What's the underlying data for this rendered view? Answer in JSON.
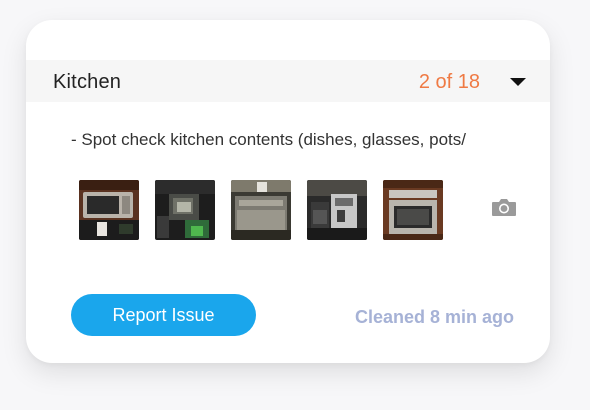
{
  "card": {
    "room": "Kitchen",
    "counter": "2 of 18",
    "task_text": "- Spot check kitchen contents (dishes, glasses, pots/",
    "photos": [
      {
        "icon": "photo-microwave"
      },
      {
        "icon": "photo-sink"
      },
      {
        "icon": "photo-dishwasher"
      },
      {
        "icon": "photo-coffee-machine"
      },
      {
        "icon": "photo-oven"
      }
    ],
    "camera_icon": "camera-icon",
    "report_button": "Report Issue",
    "status": "Cleaned 8 min ago"
  },
  "colors": {
    "accent_orange": "#ef7a44",
    "button_blue": "#1aa6ec",
    "status_gray_blue": "#a6b2d6"
  }
}
